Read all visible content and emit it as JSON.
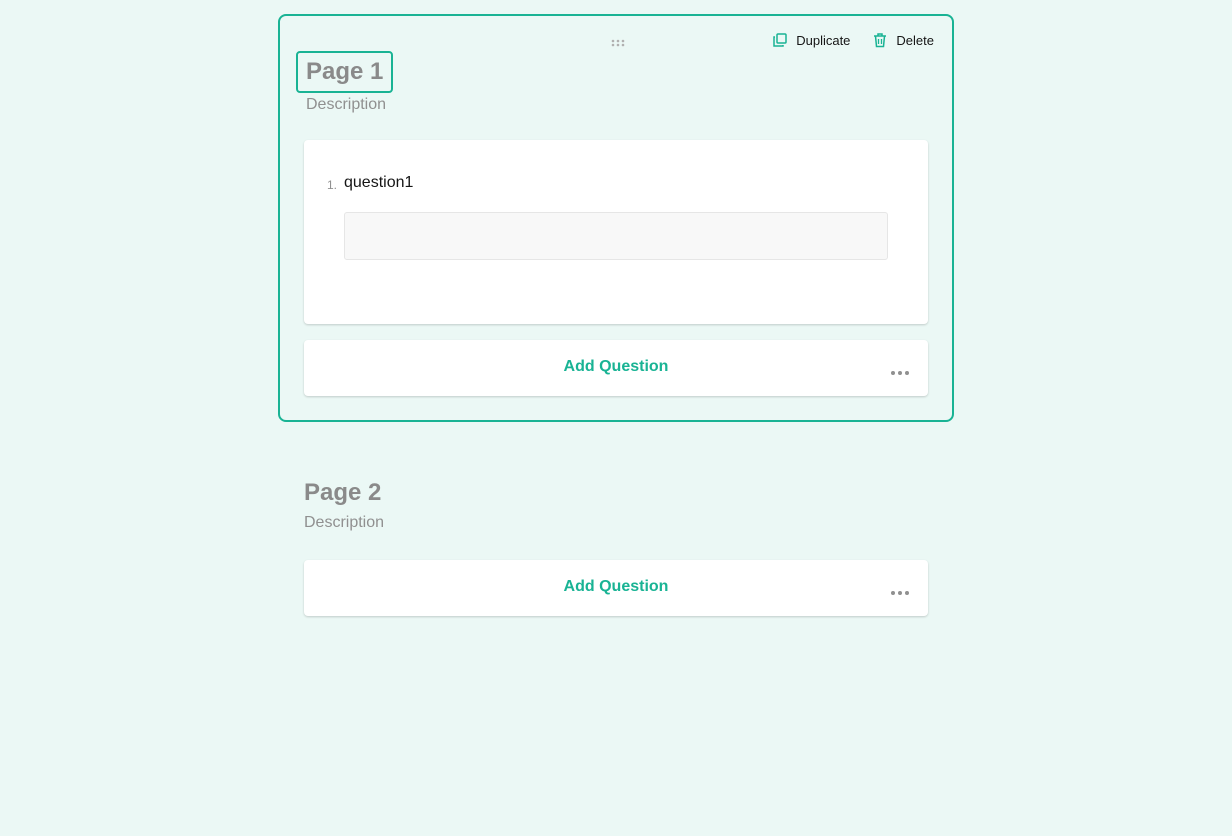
{
  "pages": [
    {
      "title": "Page 1",
      "description": "Description",
      "actions": {
        "duplicate_label": "Duplicate",
        "delete_label": "Delete"
      },
      "questions": [
        {
          "number": "1.",
          "title": "question1",
          "value": ""
        }
      ],
      "add_question_label": "Add Question"
    },
    {
      "title": "Page 2",
      "description": "Description",
      "add_question_label": "Add Question"
    }
  ],
  "colors": {
    "accent": "#19b394",
    "background": "#ebf8f5",
    "card": "#ffffff",
    "title_muted": "#8a8a8a"
  },
  "icons": {
    "drag": "drag-handle-icon",
    "duplicate": "duplicate-icon",
    "delete": "trash-icon",
    "more": "more-horizontal-icon"
  }
}
